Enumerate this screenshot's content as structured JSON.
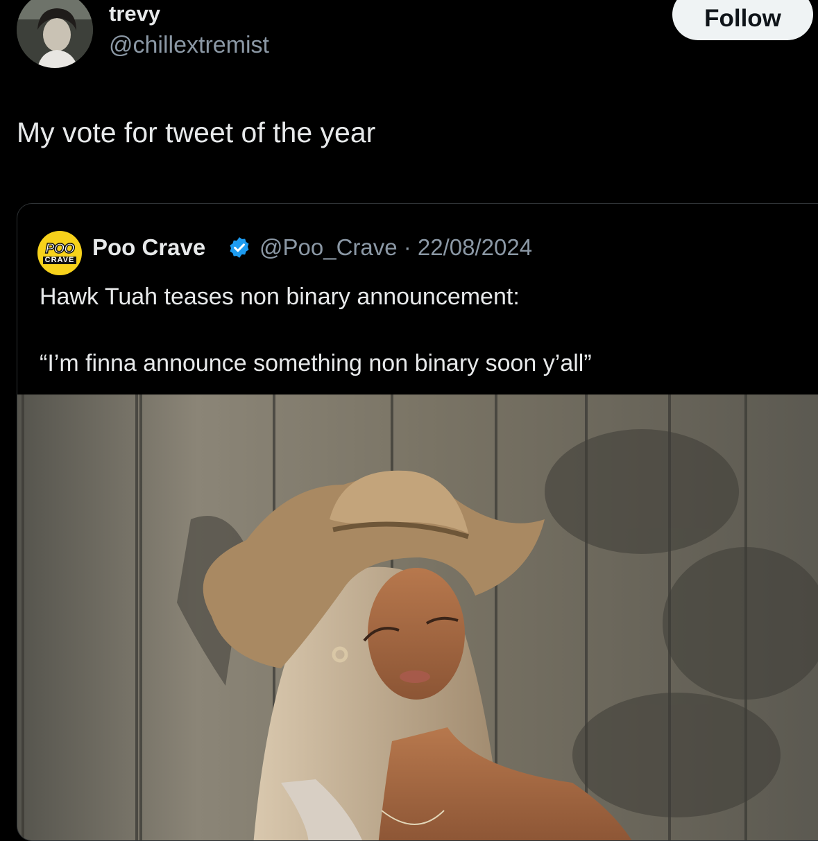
{
  "author": {
    "display_name": "trevy",
    "handle": "@chillextremist",
    "avatar_icon": "profile-photo-avatar"
  },
  "follow_button": {
    "label": "Follow"
  },
  "tweet": {
    "text": "My vote for tweet of the year"
  },
  "quoted_tweet": {
    "logo_line1": "POO",
    "logo_line2": "CRAVE",
    "display_name": "Poo Crave",
    "verified_icon": "verified-badge-icon",
    "meta": "@Poo_Crave · 22/08/2024",
    "line1": "Hawk Tuah teases non binary announcement:",
    "line2": "“I’m finna announce something non binary soon y’all”",
    "media_description_icon": "photo-woman-cowboy-hat"
  },
  "colors": {
    "background": "#000000",
    "text": "#e7e9ea",
    "secondary_text": "#8b98a5",
    "follow_bg": "#eff3f4",
    "verified_blue": "#1d9bf0",
    "logo_yellow": "#f7d21b"
  }
}
